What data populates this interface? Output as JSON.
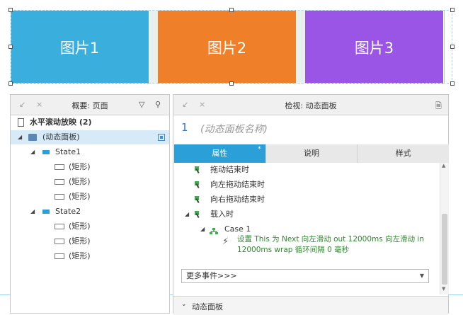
{
  "canvas": {
    "panels": [
      {
        "label": "图片1",
        "color": "#3aaedc"
      },
      {
        "label": "图片2",
        "color": "#f07f2a"
      },
      {
        "label": "图片3",
        "color": "#9b55e6"
      }
    ]
  },
  "outline": {
    "title": "概要: 页面",
    "page": "水平滚动放映 (2)",
    "panel": "(动态面板)",
    "states": [
      {
        "label": "State1",
        "children": [
          "(矩形)",
          "(矩形)",
          "(矩形)"
        ]
      },
      {
        "label": "State2",
        "children": [
          "(矩形)",
          "(矩形)",
          "(矩形)"
        ]
      }
    ]
  },
  "inspector": {
    "title": "检视: 动态面板",
    "name_index": "1",
    "name_placeholder": "(动态面板名称)",
    "tabs": [
      {
        "label": "属性",
        "active": true,
        "marker": "*"
      },
      {
        "label": "说明",
        "active": false
      },
      {
        "label": "样式",
        "active": false
      }
    ],
    "events": [
      {
        "label": "拖动结束时"
      },
      {
        "label": "向左拖动结束时"
      },
      {
        "label": "向右拖动结束时"
      },
      {
        "label": "载入时"
      }
    ],
    "case_label": "Case 1",
    "action_text": "设置 This 为 Next 向左滑动 out 12000ms 向左滑动 in 12000ms wrap 循环间隔 0 毫秒",
    "more_events": "更多事件>>>",
    "section_label": "动态面板"
  }
}
